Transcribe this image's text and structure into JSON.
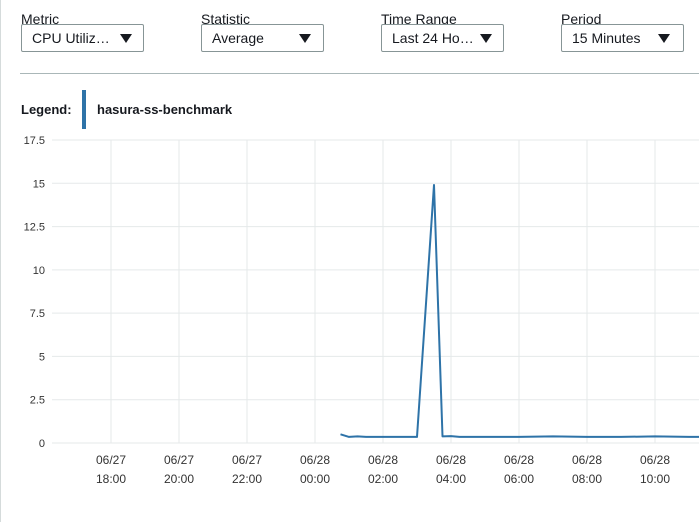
{
  "controls": {
    "metric": {
      "label": "Metric",
      "value": "CPU Utiliz…"
    },
    "statistic": {
      "label": "Statistic",
      "value": "Average"
    },
    "time_range": {
      "label": "Time Range",
      "value": "Last 24 Ho…"
    },
    "period": {
      "label": "Period",
      "value": "15 Minutes"
    }
  },
  "legend": {
    "title": "Legend:",
    "series_name": "hasura-ss-benchmark",
    "color": "#2e73a8"
  },
  "chart_data": {
    "type": "line",
    "ylim": [
      0,
      17.5
    ],
    "yticks": [
      "17.5",
      "15",
      "12.5",
      "10",
      "7.5",
      "5",
      "2.5",
      "0"
    ],
    "xticks": [
      {
        "date": "06/27",
        "time": "18:00"
      },
      {
        "date": "06/27",
        "time": "20:00"
      },
      {
        "date": "06/27",
        "time": "22:00"
      },
      {
        "date": "06/28",
        "time": "00:00"
      },
      {
        "date": "06/28",
        "time": "02:00"
      },
      {
        "date": "06/28",
        "time": "04:00"
      },
      {
        "date": "06/28",
        "time": "06:00"
      },
      {
        "date": "06/28",
        "time": "08:00"
      },
      {
        "date": "06/28",
        "time": "10:00"
      }
    ],
    "grid": true,
    "series": [
      {
        "name": "hasura-ss-benchmark",
        "points": [
          [
            "06/28 00:45",
            0.5
          ],
          [
            "06/28 01:00",
            0.35
          ],
          [
            "06/28 01:15",
            0.38
          ],
          [
            "06/28 01:30",
            0.35
          ],
          [
            "06/28 01:45",
            0.35
          ],
          [
            "06/28 02:00",
            0.35
          ],
          [
            "06/28 02:15",
            0.35
          ],
          [
            "06/28 02:30",
            0.35
          ],
          [
            "06/28 02:45",
            0.35
          ],
          [
            "06/28 03:00",
            0.35
          ],
          [
            "06/28 03:30",
            14.9
          ],
          [
            "06/28 03:45",
            0.38
          ],
          [
            "06/28 04:00",
            0.4
          ],
          [
            "06/28 04:15",
            0.35
          ],
          [
            "06/28 05:00",
            0.35
          ],
          [
            "06/28 06:00",
            0.35
          ],
          [
            "06/28 07:00",
            0.38
          ],
          [
            "06/28 08:00",
            0.35
          ],
          [
            "06/28 09:00",
            0.35
          ],
          [
            "06/28 10:00",
            0.38
          ],
          [
            "06/28 11:00",
            0.35
          ],
          [
            "06/28 11:30",
            0.35
          ]
        ]
      }
    ]
  }
}
